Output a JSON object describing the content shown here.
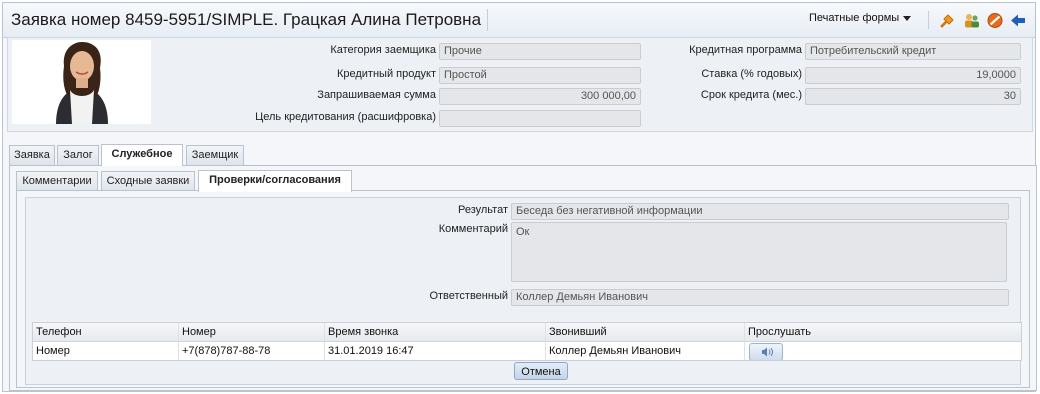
{
  "window": {
    "title": "Заявка номер 8459-5951/SIMPLE. Грацкая Алина Петровна"
  },
  "toolbar": {
    "print_forms_label": "Печатные формы"
  },
  "header": {
    "borrower_category_label": "Категория заемщика",
    "borrower_category_value": "Прочие",
    "credit_product_label": "Кредитный продукт",
    "credit_product_value": "Простой",
    "requested_amount_label": "Запрашиваемая сумма",
    "requested_amount_value": "300 000,00",
    "purpose_label": "Цель кредитования (расшифровка)",
    "purpose_value": "",
    "credit_program_label": "Кредитная программа",
    "credit_program_value": "Потребительский кредит",
    "rate_label": "Ставка (% годовых)",
    "rate_value": "19,0000",
    "term_label": "Срок кредита (мес.)",
    "term_value": "30"
  },
  "tabs": [
    "Заявка",
    "Залог",
    "Служебное",
    "Заемщик"
  ],
  "subtabs": [
    "Комментарии",
    "Сходные заявки",
    "Проверки/согласования"
  ],
  "checks": {
    "result_label": "Результат",
    "result_value": "Беседа без негативной информации",
    "comment_label": "Комментарий",
    "comment_value": "Ок",
    "responsible_label": "Ответственный",
    "responsible_value": "Коллер Демьян Иванович"
  },
  "calls_table": {
    "columns": [
      "Телефон",
      "Номер",
      "Время звонка",
      "Звонивший",
      "Прослушать"
    ],
    "rows": [
      [
        "Номер",
        "+7(878)787-88-78",
        "31.01.2019 16:47",
        "Коллер Демьян Иванович",
        ""
      ]
    ]
  },
  "buttons": {
    "cancel_label": "Отмена"
  },
  "icons": [
    "pin-icon",
    "users-icon",
    "cancel-icon",
    "back-arrow-icon"
  ],
  "colors": {
    "accent": "#1f5fb8",
    "field_bg": "#e4e6e9",
    "panel_bg": "#edf0f4"
  }
}
